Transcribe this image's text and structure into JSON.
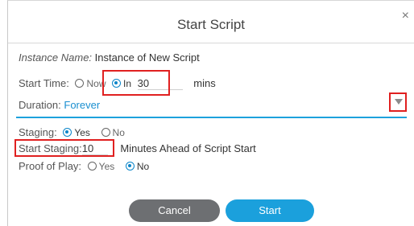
{
  "dialog": {
    "title": "Start Script",
    "close_glyph": "×"
  },
  "instance": {
    "label": "Instance Name:",
    "value": "Instance of New Script"
  },
  "start_time": {
    "label": "Start Time:",
    "opt_now": "Now",
    "opt_in": "In",
    "value": "30",
    "unit": "mins",
    "selected": "In"
  },
  "duration": {
    "label": "Duration:",
    "value": "Forever"
  },
  "staging": {
    "label": "Staging:",
    "opt_yes": "Yes",
    "opt_no": "No",
    "selected": "Yes"
  },
  "start_staging": {
    "label": "Start Staging:",
    "value": "10",
    "suffix": "Minutes Ahead of Script Start"
  },
  "proof_of_play": {
    "label": "Proof of Play:",
    "opt_yes": "Yes",
    "opt_no": "No",
    "selected": "No"
  },
  "buttons": {
    "cancel": "Cancel",
    "start": "Start"
  },
  "colors": {
    "accent": "#1ba0dc",
    "highlight": "#e02020",
    "cancel_bg": "#6d6f72"
  }
}
